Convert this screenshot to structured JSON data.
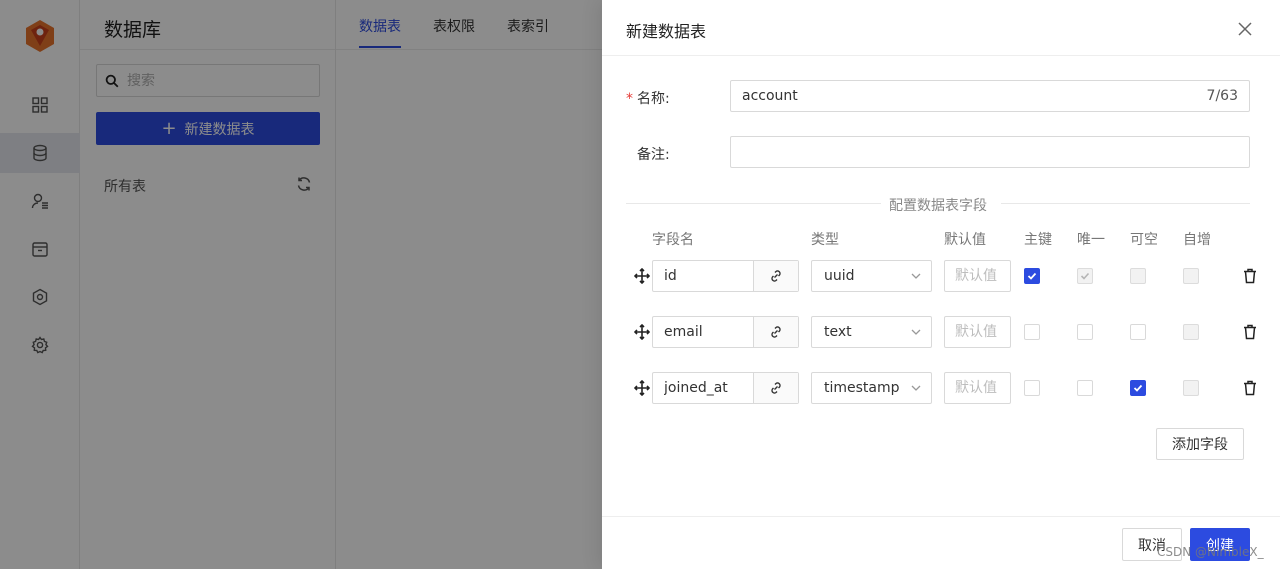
{
  "sidebar": {
    "nav_icons": [
      "dashboard-icon",
      "database-icon",
      "user-list-icon",
      "storage-icon",
      "hexagon-icon",
      "gear-icon"
    ],
    "active_index": 1
  },
  "left_panel": {
    "title": "数据库",
    "search_placeholder": "搜索",
    "new_table_label": "新建数据表",
    "all_tables_label": "所有表"
  },
  "tabs": [
    {
      "label": "数据表",
      "active": true
    },
    {
      "label": "表权限",
      "active": false
    },
    {
      "label": "表索引",
      "active": false
    }
  ],
  "drawer": {
    "title": "新建数据表",
    "name_label": "名称:",
    "name_value": "account",
    "name_count": "7/63",
    "remark_label": "备注:",
    "remark_value": "",
    "section_title": "配置数据表字段",
    "columns": {
      "field_name": "字段名",
      "type": "类型",
      "default": "默认值",
      "primary": "主键",
      "unique": "唯一",
      "nullable": "可空",
      "auto_inc": "自增"
    },
    "default_placeholder": "默认值",
    "fields": [
      {
        "name": "id",
        "type": "uuid",
        "primary": true,
        "unique": true,
        "unique_disabled": true,
        "nullable": false,
        "nullable_disabled": true,
        "auto_inc": false,
        "auto_inc_disabled": true
      },
      {
        "name": "email",
        "type": "text",
        "primary": false,
        "unique": false,
        "unique_disabled": false,
        "nullable": false,
        "nullable_disabled": false,
        "auto_inc": false,
        "auto_inc_disabled": true
      },
      {
        "name": "joined_at",
        "type": "timestamp",
        "primary": false,
        "unique": false,
        "unique_disabled": false,
        "nullable": true,
        "nullable_disabled": false,
        "auto_inc": false,
        "auto_inc_disabled": true
      }
    ],
    "add_field_label": "添加字段",
    "cancel_label": "取消",
    "create_label": "创建"
  },
  "watermark": "CSDN @NimbleX_",
  "colors": {
    "accent": "#2c4be0",
    "required": "#e53935"
  }
}
